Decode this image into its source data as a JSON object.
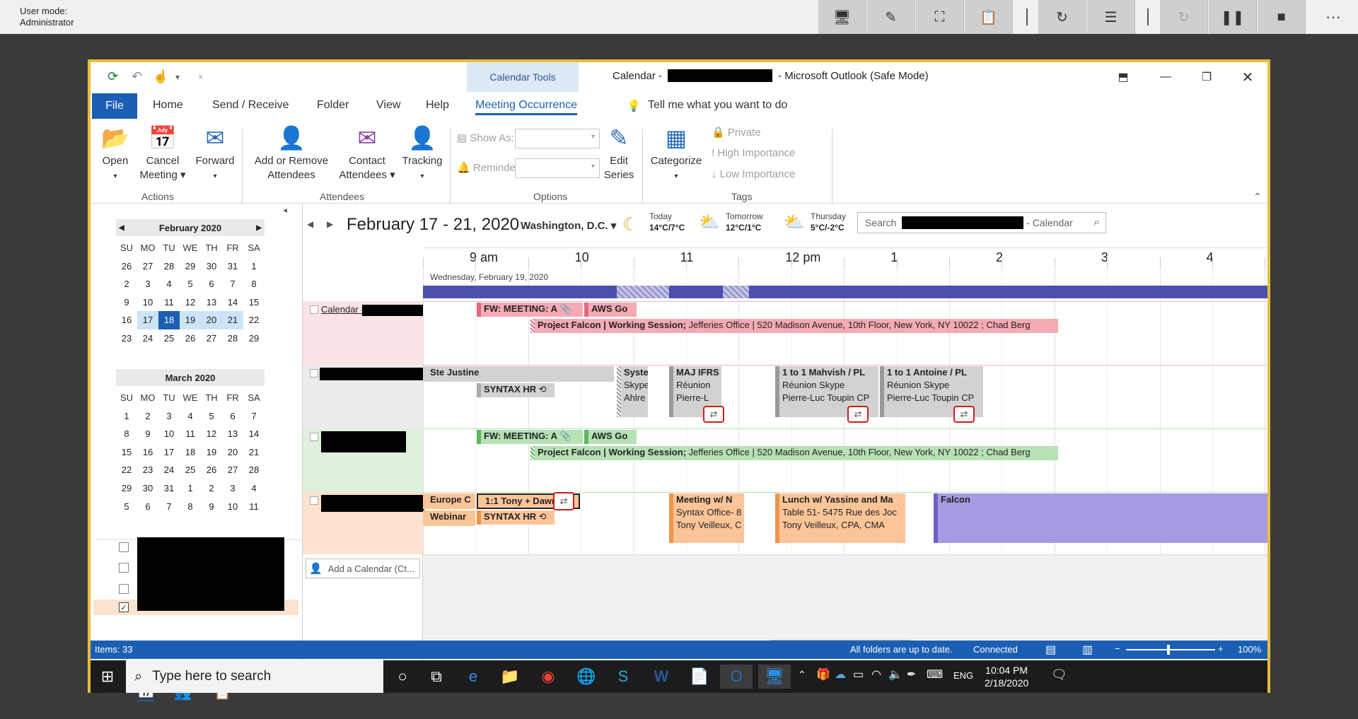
{
  "remote": {
    "mode_line1": "User mode:",
    "mode_line2": "Administrator",
    "more": "···"
  },
  "window": {
    "calendar_tools": "Calendar Tools",
    "title_prefix": "Calendar -",
    "title_suffix": "-  Microsoft Outlook (Safe Mode)",
    "tabs": {
      "file": "File",
      "home": "Home",
      "send": "Send / Receive",
      "folder": "Folder",
      "view": "View",
      "help": "Help",
      "meeting": "Meeting Occurrence",
      "tell": "Tell me what you want to do"
    }
  },
  "ribbon": {
    "open": "Open",
    "cancel1": "Cancel",
    "cancel2": "Meeting",
    "forward": "Forward",
    "addrem1": "Add or Remove",
    "addrem2": "Attendees",
    "contact1": "Contact",
    "contact2": "Attendees",
    "tracking": "Tracking",
    "showas": "Show As:",
    "reminder": "Reminder:",
    "edit1": "Edit",
    "edit2": "Series",
    "categorize": "Categorize",
    "private": "Private",
    "high": "High Importance",
    "low": "Low Importance",
    "groups": {
      "actions": "Actions",
      "attendees": "Attendees",
      "options": "Options",
      "tags": "Tags"
    }
  },
  "feb": {
    "title": "February 2020",
    "days": [
      "SU",
      "MO",
      "TU",
      "WE",
      "TH",
      "FR",
      "SA"
    ],
    "cells": [
      "26",
      "27",
      "28",
      "29",
      "30",
      "31",
      "1",
      "2",
      "3",
      "4",
      "5",
      "6",
      "7",
      "8",
      "9",
      "10",
      "11",
      "12",
      "13",
      "14",
      "15",
      "16",
      "17",
      "18",
      "19",
      "20",
      "21",
      "22",
      "23",
      "24",
      "25",
      "26",
      "27",
      "28",
      "29"
    ]
  },
  "mar": {
    "title": "March 2020",
    "days": [
      "SU",
      "MO",
      "TU",
      "WE",
      "TH",
      "FR",
      "SA"
    ],
    "cells": [
      "1",
      "2",
      "3",
      "4",
      "5",
      "6",
      "7",
      "8",
      "9",
      "10",
      "11",
      "12",
      "13",
      "14",
      "15",
      "16",
      "17",
      "18",
      "19",
      "20",
      "21",
      "22",
      "23",
      "24",
      "25",
      "26",
      "27",
      "28",
      "29",
      "30",
      "31",
      "1",
      "2",
      "3",
      "4",
      "5",
      "6",
      "7",
      "8",
      "9",
      "10",
      "11"
    ]
  },
  "header": {
    "range": "February 17 - 21, 2020",
    "location": "Washington,  D.C.",
    "today_l": "Today",
    "today_t": "14°C/7°C",
    "tom_l": "Tomorrow",
    "tom_t": "12°C/1°C",
    "thu_l": "Thursday",
    "thu_t": "5°C/-2°C",
    "search_prefix": "Search",
    "search_suffix": "- Calendar"
  },
  "times": [
    "9 am",
    "10",
    "11",
    "12 pm",
    "1",
    "2",
    "3",
    "4"
  ],
  "day_label": "Wednesday, February 19, 2020",
  "cal1_label": "Calendar -",
  "add_calendar": "Add a Calendar (Ct...",
  "events": {
    "r1a": "FW: MEETING:  A",
    "r1b": "AWS Go",
    "falcon_title": "Project Falcon | Working Session;",
    "falcon_loc": " Jefferies Office | 520 Madison Avenue, 10th Floor, New York, NY 10022 ; Chad Berg",
    "justine": "Ste Justine",
    "syntax": "SYNTAX HR",
    "sys1": "Syste",
    "sys2": "Skype",
    "sys3": "Ahlre",
    "maj1": "MAJ IFRS",
    "maj2": "Réunion",
    "maj3": "Pierre-L",
    "m1a": "1 to 1 Mahvish / PL",
    "m1b": "Réunion Skype",
    "m1c": "Pierre-Luc Toupin CP",
    "m2a": "1 to 1 Antoine / PL",
    "m2b": "Réunion Skype",
    "m2c": "Pierre-Luc Toupin CP",
    "europe": "Europe C",
    "webinar": "Webinar",
    "tony": "1:1 Tony + Dawn",
    "syntax2": "SYNTAX HR",
    "mw1": "Meeting w/ N",
    "mw2": "Syntax Office- 8",
    "mw3": "Tony Veilleux, C",
    "lunch1": "Lunch w/ Yassine and Ma",
    "lunch2": "Table 51- 5475 Rue des Joc",
    "lunch3": "Tony Veilleux, CPA, CMA",
    "falcon": "Falcon"
  },
  "status": {
    "items": "Items: 33",
    "folders": "All folders are up to date.",
    "connected": "Connected",
    "zoom": "100%"
  },
  "taskbar": {
    "search": "Type here to search",
    "lang": "ENG",
    "time": "10:04 PM",
    "date": "2/18/2020"
  },
  "colors": {
    "pink": "#f5aab4",
    "grey": "#d2d2d2",
    "green": "#b6e2b6",
    "orange": "#fcc598",
    "purple": "#a89ae2",
    "navy": "#4b4fae"
  }
}
